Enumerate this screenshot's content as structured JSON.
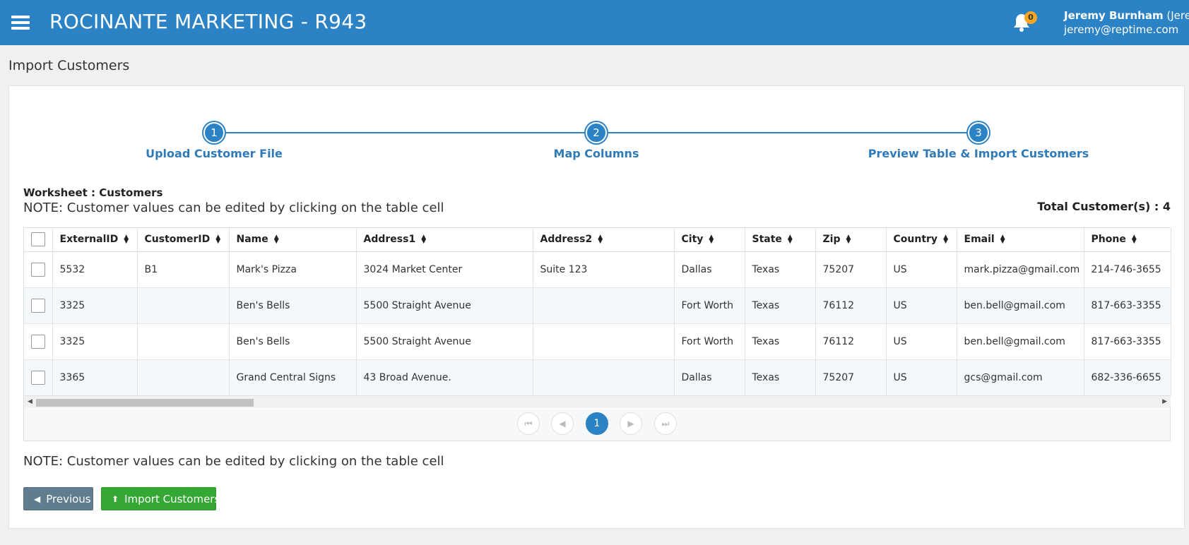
{
  "header": {
    "title": "ROCINANTE MARKETING - R943",
    "notification_count": "0",
    "user_name": "Jeremy Burnham",
    "user_nick": "(Jeremy)",
    "user_email": "jeremy@reptime.com"
  },
  "page": {
    "title": "Import Customers"
  },
  "steps": [
    {
      "number": "1",
      "label": "Upload Customer File"
    },
    {
      "number": "2",
      "label": "Map Columns"
    },
    {
      "number": "3",
      "label": "Preview Table & Import Customers"
    }
  ],
  "worksheet_label": "Worksheet : Customers",
  "note_text": "NOTE: Customer values can be edited by clicking on the table cell",
  "total_label": "Total Customer(s) : 4",
  "table": {
    "columns": [
      "ExternalID",
      "CustomerID",
      "Name",
      "Address1",
      "Address2",
      "City",
      "State",
      "Zip",
      "Country",
      "Email",
      "Phone"
    ],
    "rows": [
      [
        "5532",
        "B1",
        "Mark's Pizza",
        "3024 Market Center",
        "Suite 123",
        "Dallas",
        "Texas",
        "75207",
        "US",
        "mark.pizza@gmail.com",
        "214-746-3655"
      ],
      [
        "3325",
        "",
        "Ben's Bells",
        "5500 Straight Avenue",
        "",
        "Fort Worth",
        "Texas",
        "76112",
        "US",
        "ben.bell@gmail.com",
        "817-663-3355"
      ],
      [
        "3325",
        "",
        "Ben's Bells",
        "5500 Straight Avenue",
        "",
        "Fort Worth",
        "Texas",
        "76112",
        "US",
        "ben.bell@gmail.com",
        "817-663-3355"
      ],
      [
        "3365",
        "",
        "Grand Central Signs",
        "43 Broad Avenue.",
        "",
        "Dallas",
        "Texas",
        "75207",
        "US",
        "gcs@gmail.com",
        "682-336-6655"
      ]
    ]
  },
  "pagination": {
    "current_page": "1"
  },
  "buttons": {
    "previous": "Previous",
    "import": "Import Customers"
  },
  "colors": {
    "header_bg": "#2b82c4",
    "step_color": "#2f7ab8",
    "import_button": "#34a734",
    "previous_button": "#5f7d8e",
    "badge": "#f5a623"
  },
  "icons": {
    "menu": "hamburger-menu-icon",
    "notifications": "bell-icon",
    "previous": "chevron-circle-left-icon",
    "import": "upload-icon"
  }
}
